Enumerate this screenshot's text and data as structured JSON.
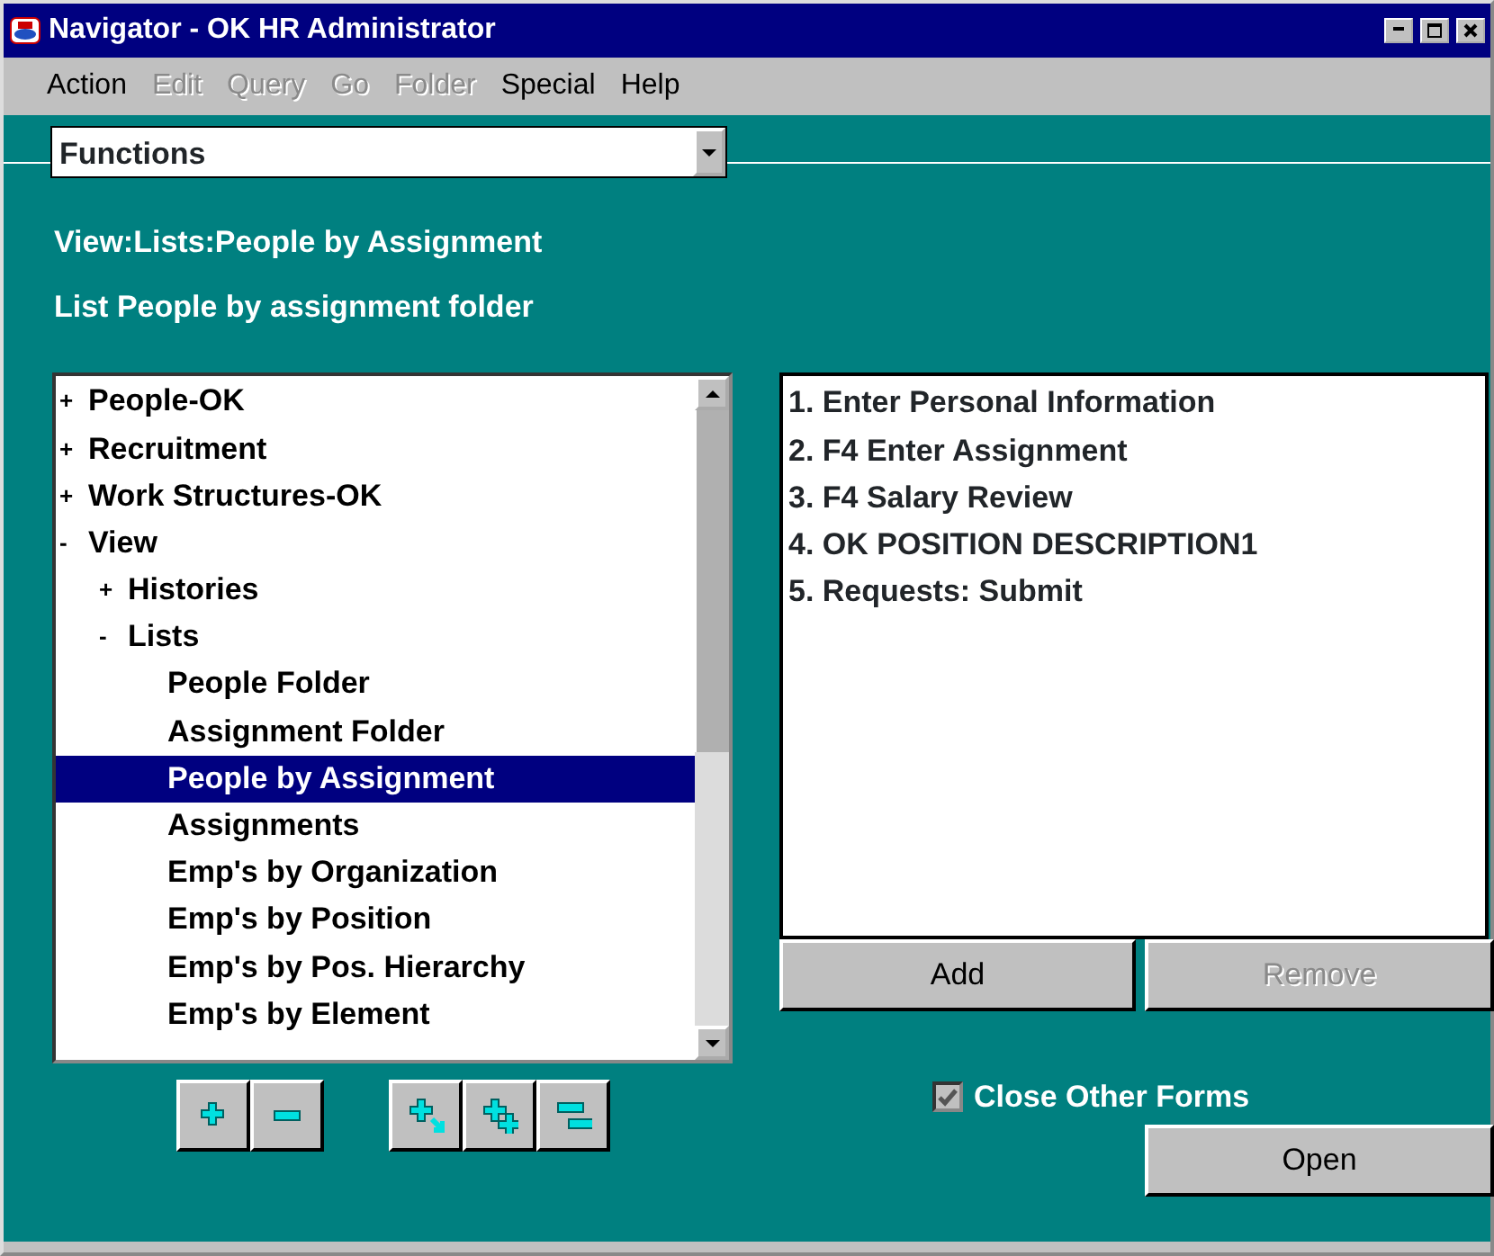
{
  "window": {
    "title": "Navigator - OK HR Administrator"
  },
  "menu": [
    {
      "label": "Action",
      "disabled": false
    },
    {
      "label": "Edit",
      "disabled": true
    },
    {
      "label": "Query",
      "disabled": true
    },
    {
      "label": "Go",
      "disabled": true
    },
    {
      "label": "Folder",
      "disabled": true
    },
    {
      "label": "Special",
      "disabled": false
    },
    {
      "label": "Help",
      "disabled": false
    }
  ],
  "combo": {
    "value": "Functions"
  },
  "path": "View:Lists:People by Assignment",
  "description": "List People by assignment folder",
  "tree": [
    {
      "label": "People-OK",
      "marker": "+",
      "selected": false
    },
    {
      "label": "Recruitment",
      "marker": "+",
      "selected": false
    },
    {
      "label": "Work Structures-OK",
      "marker": "+",
      "selected": false
    },
    {
      "label": "View",
      "marker": "-",
      "selected": false,
      "children": [
        {
          "label": "Histories",
          "marker": "+",
          "selected": false
        },
        {
          "label": "Lists",
          "marker": "-",
          "selected": false,
          "children": [
            {
              "label": "People Folder",
              "selected": false
            },
            {
              "label": "Assignment Folder",
              "selected": false
            },
            {
              "label": "People by Assignment",
              "selected": true
            },
            {
              "label": "Assignments",
              "selected": false
            },
            {
              "label": "Emp's by Organization",
              "selected": false
            },
            {
              "label": "Emp's by Position",
              "selected": false
            },
            {
              "label": "Emp's by Pos. Hierarchy",
              "selected": false
            },
            {
              "label": "Emp's by Element",
              "selected": false
            }
          ]
        }
      ]
    }
  ],
  "tree_buttons": [
    {
      "kind": "expand"
    },
    {
      "kind": "collapse"
    },
    {
      "kind": "expand-branch"
    },
    {
      "kind": "expand-all"
    },
    {
      "kind": "collapse-all"
    }
  ],
  "favorites": [
    "1. Enter Personal Information",
    "2. F4 Enter Assignment",
    "3. F4 Salary Review",
    "4. OK POSITION DESCRIPTION1",
    "5. Requests: Submit"
  ],
  "add_button": {
    "label": "Add",
    "disabled": false
  },
  "remove_button": {
    "label": "Remove",
    "disabled": true
  },
  "close_other_forms": {
    "label": "Close Other Forms",
    "checked": true
  },
  "open_button": {
    "label": "Open",
    "disabled": false
  }
}
